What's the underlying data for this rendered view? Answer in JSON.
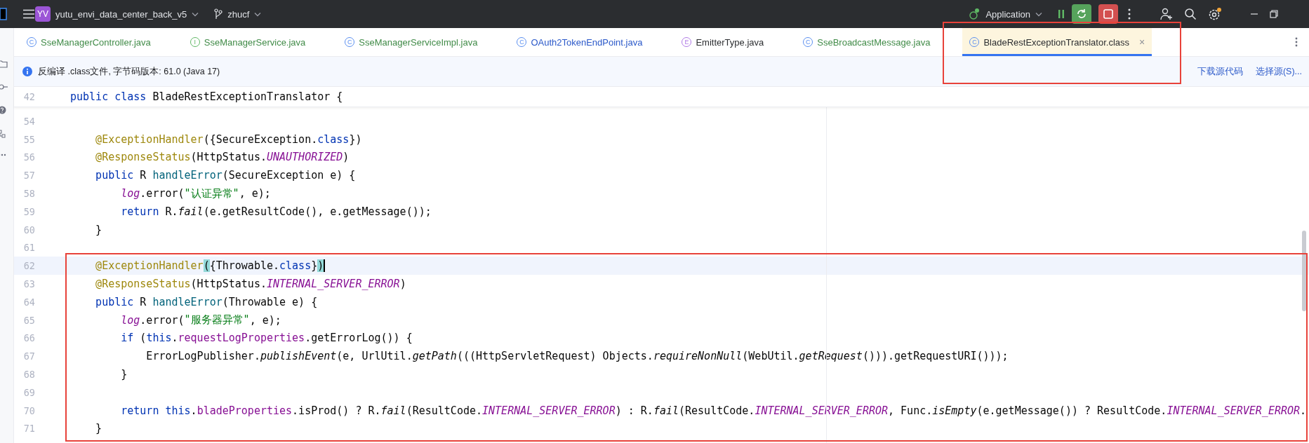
{
  "title_bar": {
    "project_badge": "YV",
    "project": "yutu_envi_data_center_back_v5",
    "branch": "zhucf",
    "run_config": "Application"
  },
  "tabs": [
    {
      "icon": "C",
      "kind": "class",
      "label": "SseManagerController.java",
      "color": "#418b48",
      "selected": false,
      "outlined": false
    },
    {
      "icon": "I",
      "kind": "interface",
      "label": "SseManagerService.java",
      "color": "#418b48",
      "selected": false,
      "outlined": false
    },
    {
      "icon": "C",
      "kind": "class",
      "label": "SseManagerServiceImpl.java",
      "color": "#418b48",
      "selected": false,
      "outlined": false
    },
    {
      "icon": "C",
      "kind": "class",
      "label": "OAuth2TokenEndPoint.java",
      "color": "#2a58c9",
      "selected": false,
      "outlined": false
    },
    {
      "icon": "E",
      "kind": "enum",
      "label": "EmitterType.java",
      "color": "#2b2d30",
      "selected": false,
      "outlined": false
    },
    {
      "icon": "C",
      "kind": "class",
      "label": "SseBroadcastMessage.java",
      "color": "#418b48",
      "selected": false,
      "outlined": false
    },
    {
      "icon": "C",
      "kind": "class",
      "label": "BladeRestExceptionTranslator.class",
      "color": "#2b2d30",
      "selected": true,
      "outlined": true,
      "close": "×"
    }
  ],
  "info_bar": {
    "text": "反编译 .class文件, 字节码版本: 61.0 (Java 17)",
    "links": [
      "下载源代码",
      "选择源(S)..."
    ]
  },
  "editor": {
    "sticky_line": {
      "num": "42",
      "tokens": [
        {
          "text": "public class",
          "kind": "kw"
        },
        {
          "text": " BladeRestExceptionTranslator {",
          "kind": "plain"
        }
      ]
    },
    "lines": [
      {
        "num": "54",
        "current": false,
        "outlined": false
      },
      {
        "num": "55",
        "current": false,
        "outlined": false,
        "tokens": [
          {
            "text": "    @ExceptionHandler",
            "kind": "ann"
          },
          {
            "text": "({SecureException.",
            "kind": "plain"
          },
          {
            "text": "class",
            "kind": "kw"
          },
          {
            "text": "})",
            "kind": "plain"
          }
        ]
      },
      {
        "num": "56",
        "current": false,
        "outlined": false,
        "tokens": [
          {
            "text": "    @ResponseStatus",
            "kind": "ann"
          },
          {
            "text": "(HttpStatus.",
            "kind": "plain"
          },
          {
            "text": "UNAUTHORIZED",
            "kind": "static"
          },
          {
            "text": ")",
            "kind": "plain"
          }
        ]
      },
      {
        "num": "57",
        "current": false,
        "outlined": false,
        "tokens": [
          {
            "text": "    public",
            "kind": "kw"
          },
          {
            "text": " R ",
            "kind": "plain"
          },
          {
            "text": "handleError",
            "kind": "method"
          },
          {
            "text": "(SecureException e) {",
            "kind": "plain"
          }
        ]
      },
      {
        "num": "58",
        "current": false,
        "outlined": false,
        "tokens": [
          {
            "text": "        log",
            "kind": "static"
          },
          {
            "text": ".error(",
            "kind": "plain"
          },
          {
            "text": "\"认证异常\"",
            "kind": "str"
          },
          {
            "text": ", e);",
            "kind": "plain"
          }
        ]
      },
      {
        "num": "59",
        "current": false,
        "outlined": false,
        "tokens": [
          {
            "text": "        return",
            "kind": "kw"
          },
          {
            "text": " R.",
            "kind": "plain"
          },
          {
            "text": "fail",
            "kind": "italic"
          },
          {
            "text": "(e.getResultCode(), e.getMessage());",
            "kind": "plain"
          }
        ]
      },
      {
        "num": "60",
        "current": false,
        "outlined": false,
        "tokens": [
          {
            "text": "    }",
            "kind": "plain"
          }
        ]
      },
      {
        "num": "61",
        "current": false,
        "outlined": false
      },
      {
        "num": "62",
        "current": true,
        "outlined": true,
        "tokens": [
          {
            "text": "    @ExceptionHandler",
            "kind": "ann"
          },
          {
            "text": "(",
            "kind": "brace"
          },
          {
            "text": "{Throwable.",
            "kind": "plain"
          },
          {
            "text": "class",
            "kind": "kw"
          },
          {
            "text": "}",
            "kind": "plain"
          },
          {
            "text": ")",
            "kind": "brace"
          }
        ]
      },
      {
        "num": "63",
        "current": false,
        "outlined": true,
        "tokens": [
          {
            "text": "    @ResponseStatus",
            "kind": "ann"
          },
          {
            "text": "(HttpStatus.",
            "kind": "plain"
          },
          {
            "text": "INTERNAL_SERVER_ERROR",
            "kind": "static"
          },
          {
            "text": ")",
            "kind": "plain"
          }
        ]
      },
      {
        "num": "64",
        "current": false,
        "outlined": true,
        "tokens": [
          {
            "text": "    public",
            "kind": "kw"
          },
          {
            "text": " R ",
            "kind": "plain"
          },
          {
            "text": "handleError",
            "kind": "method"
          },
          {
            "text": "(Throwable e) {",
            "kind": "plain"
          }
        ]
      },
      {
        "num": "65",
        "current": false,
        "outlined": true,
        "tokens": [
          {
            "text": "        log",
            "kind": "static"
          },
          {
            "text": ".error(",
            "kind": "plain"
          },
          {
            "text": "\"服务器异常\"",
            "kind": "str"
          },
          {
            "text": ", e);",
            "kind": "plain"
          }
        ]
      },
      {
        "num": "66",
        "current": false,
        "outlined": true,
        "tokens": [
          {
            "text": "        if",
            "kind": "kw"
          },
          {
            "text": " (",
            "kind": "plain"
          },
          {
            "text": "this",
            "kind": "kw"
          },
          {
            "text": ".",
            "kind": "plain"
          },
          {
            "text": "requestLogProperties",
            "kind": "field"
          },
          {
            "text": ".getErrorLog()) {",
            "kind": "plain"
          }
        ]
      },
      {
        "num": "67",
        "current": false,
        "outlined": true,
        "tokens": [
          {
            "text": "            ErrorLogPublisher.",
            "kind": "plain"
          },
          {
            "text": "publishEvent",
            "kind": "italic"
          },
          {
            "text": "(e, UrlUtil.",
            "kind": "plain"
          },
          {
            "text": "getPath",
            "kind": "italic"
          },
          {
            "text": "(((HttpServletRequest) Objects.",
            "kind": "plain"
          },
          {
            "text": "requireNonNull",
            "kind": "italic"
          },
          {
            "text": "(WebUtil.",
            "kind": "plain"
          },
          {
            "text": "getRequest",
            "kind": "italic"
          },
          {
            "text": "())).getRequestURI()));",
            "kind": "plain"
          }
        ]
      },
      {
        "num": "68",
        "current": false,
        "outlined": true,
        "tokens": [
          {
            "text": "        }",
            "kind": "plain"
          }
        ]
      },
      {
        "num": "69",
        "current": false,
        "outlined": true
      },
      {
        "num": "70",
        "current": false,
        "outlined": true,
        "tokens": [
          {
            "text": "        return this",
            "kind": "kw"
          },
          {
            "text": ".",
            "kind": "plain"
          },
          {
            "text": "bladeProperties",
            "kind": "field"
          },
          {
            "text": ".isProd() ? R.",
            "kind": "plain"
          },
          {
            "text": "fail",
            "kind": "italic"
          },
          {
            "text": "(ResultCode.",
            "kind": "plain"
          },
          {
            "text": "INTERNAL_SERVER_ERROR",
            "kind": "static"
          },
          {
            "text": ") : R.",
            "kind": "plain"
          },
          {
            "text": "fail",
            "kind": "italic"
          },
          {
            "text": "(ResultCode.",
            "kind": "plain"
          },
          {
            "text": "INTERNAL_SERVER_ERROR",
            "kind": "static"
          },
          {
            "text": ", Func.",
            "kind": "plain"
          },
          {
            "text": "isEmpty",
            "kind": "italic"
          },
          {
            "text": "(e.getMessage()) ? ResultCode.",
            "kind": "plain"
          },
          {
            "text": "INTERNAL_SERVER_ERROR",
            "kind": "static"
          },
          {
            "text": ".",
            "kind": "plain"
          }
        ]
      },
      {
        "num": "71",
        "current": false,
        "outlined": true,
        "tokens": [
          {
            "text": "    }",
            "kind": "plain"
          }
        ]
      }
    ]
  }
}
